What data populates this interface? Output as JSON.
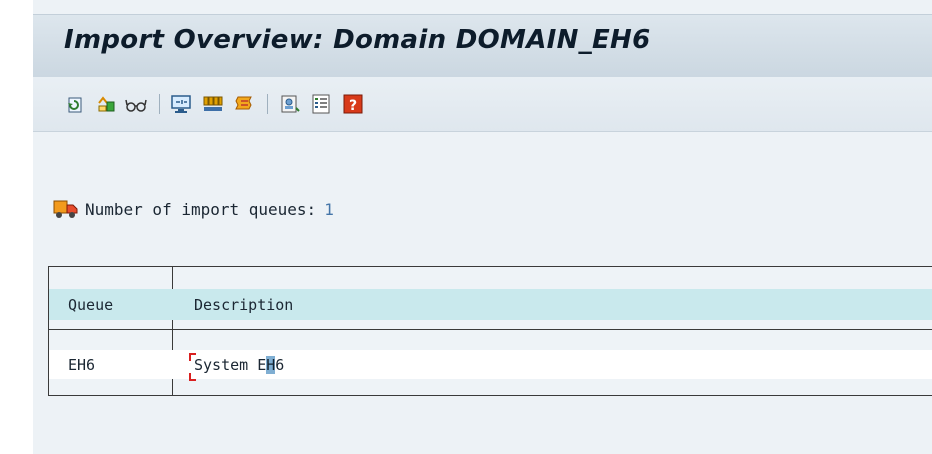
{
  "page": {
    "title": "Import Overview: Domain DOMAIN_EH6"
  },
  "toolbar": {
    "buttons": [
      {
        "name": "refresh-button",
        "icon": "refresh-icon"
      },
      {
        "name": "import-button",
        "icon": "import-truck-icon"
      },
      {
        "name": "display-button",
        "icon": "glasses-icon"
      },
      {
        "name": "monitor-button",
        "icon": "monitor-icon"
      },
      {
        "name": "queue-button",
        "icon": "queue-bars-icon"
      },
      {
        "name": "history-button",
        "icon": "history-scroll-icon"
      },
      {
        "name": "system-button",
        "icon": "system-icon"
      },
      {
        "name": "list-button",
        "icon": "list-icon"
      },
      {
        "name": "help-button",
        "icon": "help-icon"
      }
    ]
  },
  "summary": {
    "label": "Number of import queues:",
    "count": "1",
    "icon": "truck-icon"
  },
  "table": {
    "columns": [
      "Queue",
      "Description"
    ],
    "rows": [
      {
        "queue": "EH6",
        "description_prefix": "System E",
        "description_highlight": "H",
        "description_suffix": "6"
      }
    ]
  },
  "colors": {
    "header_bg": "#c9e9ed",
    "count_value": "#4475a8",
    "selection": "#7faed2",
    "cursor": "#d92020"
  }
}
